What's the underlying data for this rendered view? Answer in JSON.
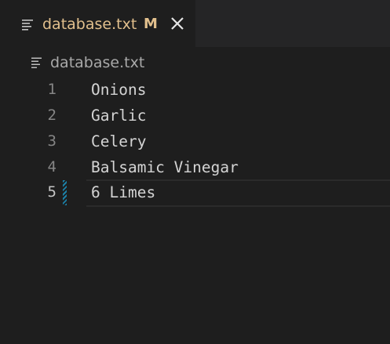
{
  "tab": {
    "title": "database.txt",
    "modified_marker": "M",
    "close_icon": "close-icon",
    "file_icon": "text-file-icon"
  },
  "breadcrumb": {
    "file_icon": "text-file-icon",
    "label": "database.txt"
  },
  "editor": {
    "current_line": 5,
    "lines": [
      {
        "number": "1",
        "text": "Onions"
      },
      {
        "number": "2",
        "text": "Garlic"
      },
      {
        "number": "3",
        "text": "Celery"
      },
      {
        "number": "4",
        "text": "Balsamic Vinegar"
      },
      {
        "number": "5",
        "text": "6 Limes"
      }
    ]
  },
  "colors": {
    "background": "#1e1e1e",
    "tabbar": "#252526",
    "modified_text": "#e2c08d",
    "line_number": "#858585",
    "code_text": "#d4d4d4",
    "gutter_modified": "#1b81a8"
  }
}
